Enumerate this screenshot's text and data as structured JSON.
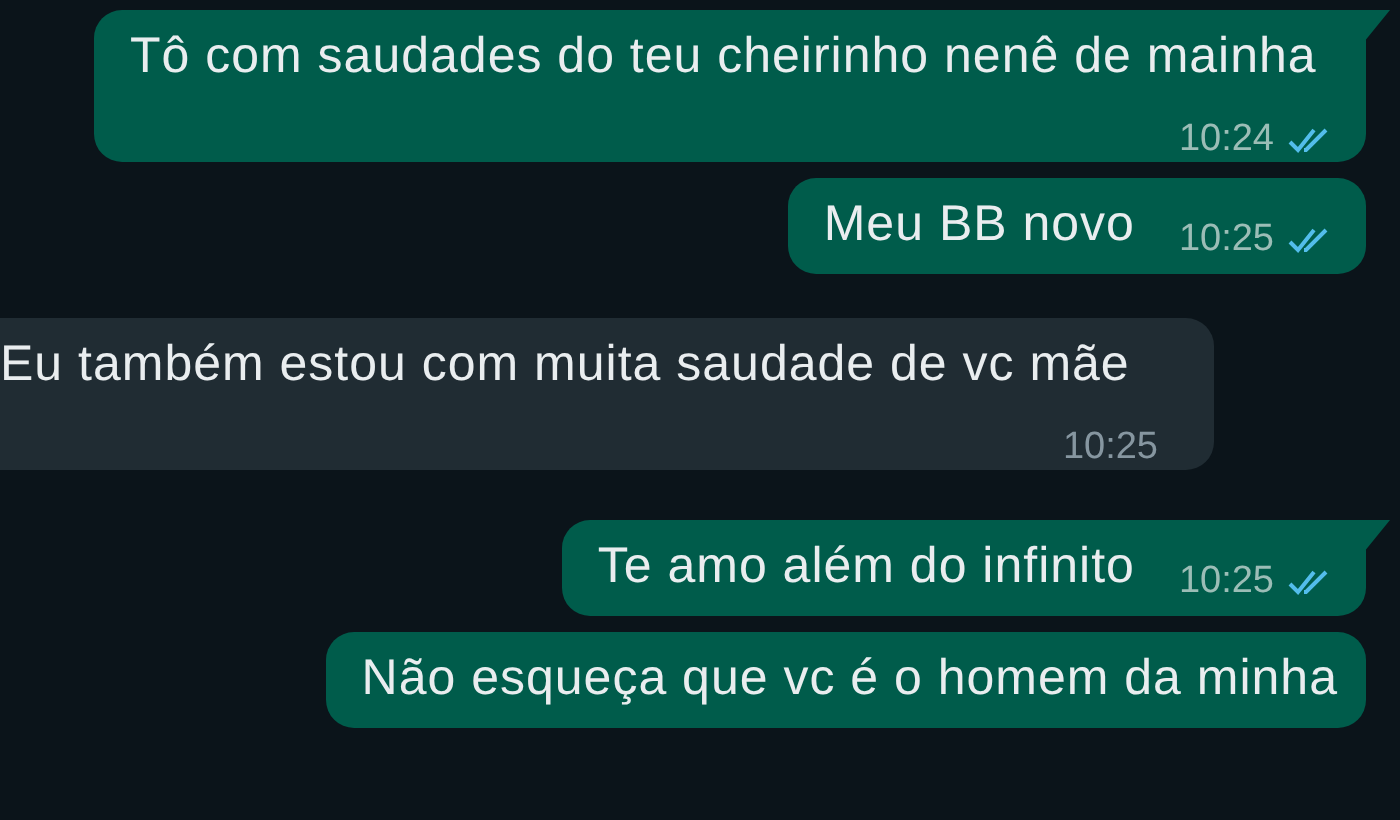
{
  "messages": [
    {
      "kind": "outgoing",
      "tail": true,
      "text": "Tô com saudades do teu cheirinho nenê de mainha",
      "time": "10:24",
      "read": true
    },
    {
      "kind": "outgoing",
      "tail": false,
      "text": "Meu BB novo",
      "time": "10:25",
      "read": true
    },
    {
      "kind": "incoming",
      "tail": false,
      "text": "Eu também estou com muita saudade de vc mãe",
      "time": "10:25"
    },
    {
      "kind": "outgoing",
      "tail": true,
      "text": "Te amo além do infinito",
      "time": "10:25",
      "read": true
    },
    {
      "kind": "outgoing",
      "tail": false,
      "text": "Não esqueça que vc é o homem da minha"
    }
  ]
}
